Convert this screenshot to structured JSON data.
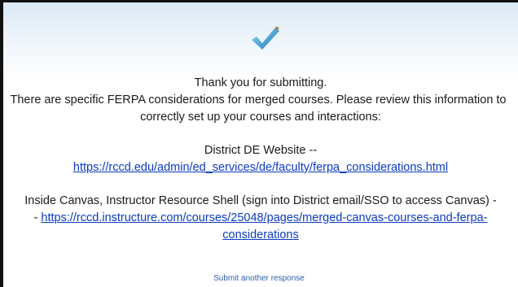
{
  "confirmation": {
    "line1": "Thank you for submitting.",
    "line2": "There are specific FERPA considerations for merged courses. Please review this information to",
    "line3": "correctly set up your courses and interactions:",
    "district_label": "District DE Website --",
    "district_link": "https://rccd.edu/admin/ed_services/de/faculty/ferpa_considerations.html",
    "canvas_text_1": "Inside Canvas, Instructor Resource Shell (sign into District email/SSO to access Canvas) -",
    "canvas_prefix": "- ",
    "canvas_link_1": "https://rccd.instructure.com/courses/25048/pages/merged-canvas-courses-and-ferpa-",
    "canvas_link_2": "considerations"
  },
  "footer": {
    "submit_another": "Submit another response"
  },
  "icons": {
    "success": "checkmark-icon"
  },
  "colors": {
    "check_light": "#7bd3e8",
    "check_dark": "#1e6fb8",
    "link": "#0b3bbf"
  }
}
